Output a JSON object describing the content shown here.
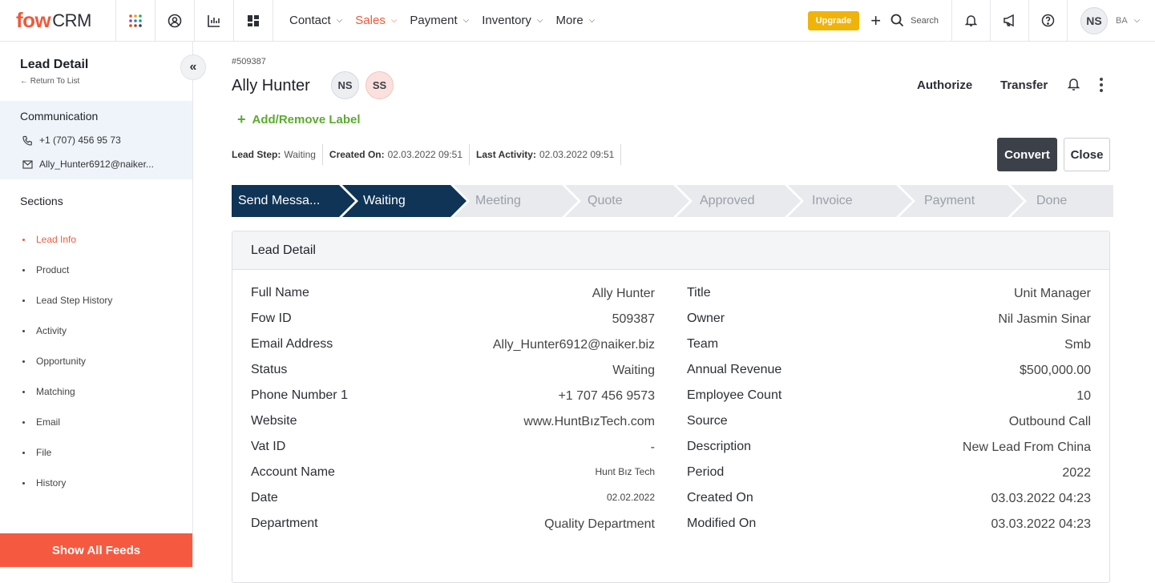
{
  "logo": {
    "prefix": "fow",
    "suffix": "CRM"
  },
  "nav": [
    {
      "label": "Contact",
      "active": false
    },
    {
      "label": "Sales",
      "active": true
    },
    {
      "label": "Payment",
      "active": false
    },
    {
      "label": "Inventory",
      "active": false
    },
    {
      "label": "More",
      "active": false
    }
  ],
  "header": {
    "upgrade": "Upgrade",
    "search": "Search",
    "user_initials": "NS",
    "user_short": "BA"
  },
  "sidebar": {
    "title": "Lead Detail",
    "return": "Return To List",
    "communication_title": "Communication",
    "phone": "+1 (707) 456 95 73",
    "email": "Ally_Hunter6912@naiker...",
    "sections_title": "Sections",
    "sections": [
      "Lead Info",
      "Product",
      "Lead Step History",
      "Activity",
      "Opportunity",
      "Matching",
      "Email",
      "File",
      "History"
    ],
    "feeds_button": "Show All Feeds"
  },
  "lead": {
    "id": "#509387",
    "name": "Ally Hunter",
    "avatars": [
      "NS",
      "SS"
    ],
    "authorize": "Authorize",
    "transfer": "Transfer",
    "add_label": "Add/Remove Label",
    "meta": {
      "step_label": "Lead Step:",
      "step_value": "Waiting",
      "created_label": "Created On:",
      "created_value": "02.03.2022 09:51",
      "activity_label": "Last Activity:",
      "activity_value": "02.03.2022 09:51"
    },
    "convert": "Convert",
    "close": "Close"
  },
  "steps": [
    "Send Messa...",
    "Waiting",
    "Meeting",
    "Quote",
    "Approved",
    "Invoice",
    "Payment",
    "Done"
  ],
  "card": {
    "title": "Lead Detail",
    "left": [
      {
        "label": "Full Name",
        "value": "Ally Hunter"
      },
      {
        "label": "Fow ID",
        "value": "509387"
      },
      {
        "label": "Email Address",
        "value": "Ally_Hunter6912@naiker.biz"
      },
      {
        "label": "Status",
        "value": "Waiting"
      },
      {
        "label": "Phone Number 1",
        "value": "+1 707 456 9573"
      },
      {
        "label": "Website",
        "value": "www.HuntBızTech.com"
      },
      {
        "label": "Vat ID",
        "value": "-"
      },
      {
        "label": "Account Name",
        "value": "Hunt Bız Tech"
      },
      {
        "label": "Date",
        "value": "02.02.2022"
      },
      {
        "label": "Department",
        "value": "Quality Department"
      }
    ],
    "right": [
      {
        "label": "Title",
        "value": "Unit Manager"
      },
      {
        "label": "Owner",
        "value": "Nil Jasmin Sinar"
      },
      {
        "label": "Team",
        "value": "Smb"
      },
      {
        "label": "Annual Revenue",
        "value": "$500,000.00"
      },
      {
        "label": "Employee Count",
        "value": "10"
      },
      {
        "label": "Source",
        "value": "Outbound Call"
      },
      {
        "label": "Description",
        "value": "New Lead From China"
      },
      {
        "label": "Period",
        "value": "2022"
      },
      {
        "label": "Created On",
        "value": "03.03.2022 04:23"
      },
      {
        "label": "Modified On",
        "value": "03.03.2022 04:23"
      }
    ]
  }
}
